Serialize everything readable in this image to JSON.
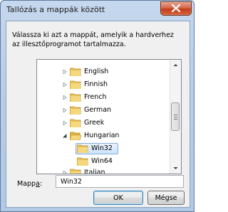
{
  "window": {
    "title": "Tallózás a mappák között",
    "close_icon": "close-icon"
  },
  "description": "Válassza ki azt a mappát, amelyik a hardverhez az illesztőprogramot tartalmazza.",
  "tree": {
    "items": [
      {
        "label": "English",
        "expanded": false,
        "selected": false
      },
      {
        "label": "Finnish",
        "expanded": false,
        "selected": false
      },
      {
        "label": "French",
        "expanded": false,
        "selected": false
      },
      {
        "label": "German",
        "expanded": false,
        "selected": false
      },
      {
        "label": "Greek",
        "expanded": false,
        "selected": false
      },
      {
        "label": "Hungarian",
        "expanded": true,
        "selected": false
      },
      {
        "label": "Win32",
        "expanded": null,
        "selected": true
      },
      {
        "label": "Win64",
        "expanded": null,
        "selected": false
      },
      {
        "label": "Italian",
        "expanded": false,
        "selected": false
      }
    ]
  },
  "folder": {
    "label_prefix": "Mapp",
    "label_underlined": "a",
    "label_suffix": ":",
    "value": "Win32"
  },
  "buttons": {
    "ok": "OK",
    "cancel": "Mégse"
  },
  "colors": {
    "folder": "#e8c15a",
    "selection": "#cde4fb",
    "close_button": "#c23b1a"
  }
}
